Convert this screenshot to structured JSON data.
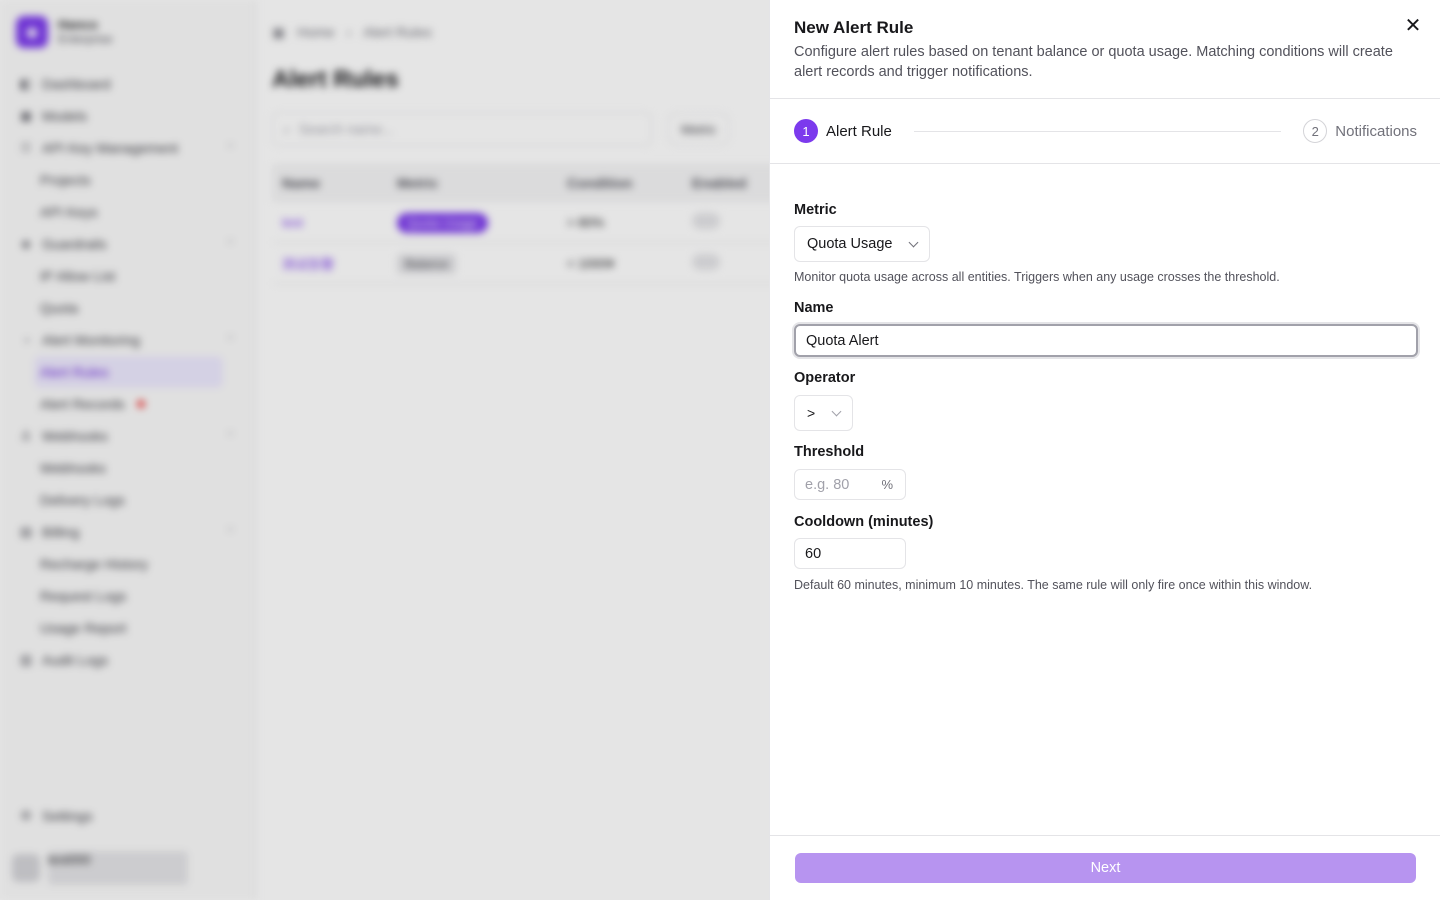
{
  "background": {
    "brand": {
      "name": "Hanco",
      "plan": "Enterprise"
    },
    "nav": [
      {
        "label": "Dashboard",
        "icon": "dashboard-icon",
        "level": 0
      },
      {
        "label": "Models",
        "icon": "box-icon",
        "level": 0
      },
      {
        "label": "API Key Management",
        "icon": "key-icon",
        "level": 0,
        "expanded": true
      },
      {
        "label": "Projects",
        "level": 1
      },
      {
        "label": "API Keys",
        "level": 1
      },
      {
        "label": "Guardrails",
        "icon": "shield-icon",
        "level": 0,
        "expanded": true
      },
      {
        "label": "IP Allow List",
        "level": 1
      },
      {
        "label": "Quota",
        "level": 1
      },
      {
        "label": "Alert Monitoring",
        "icon": "bell-icon",
        "level": 0,
        "expanded": true
      },
      {
        "label": "Alert Rules",
        "level": 1,
        "active": true
      },
      {
        "label": "Alert Records",
        "level": 1,
        "badge": true
      },
      {
        "label": "Webhooks",
        "icon": "webhook-icon",
        "level": 0,
        "expanded": true
      },
      {
        "label": "Webhooks",
        "level": 1
      },
      {
        "label": "Delivery Logs",
        "level": 1
      },
      {
        "label": "Billing",
        "icon": "billing-icon",
        "level": 0,
        "expanded": true
      },
      {
        "label": "Recharge History",
        "level": 1
      },
      {
        "label": "Request Logs",
        "level": 1
      },
      {
        "label": "Usage Report",
        "level": 1
      },
      {
        "label": "Audit Logs",
        "icon": "audit-icon",
        "level": 0
      }
    ],
    "settings_label": "Settings",
    "user_name": "test000",
    "breadcrumb": {
      "home": "Home",
      "current": "Alert Rules"
    },
    "page_title": "Alert Rules",
    "search_placeholder": "Search name...",
    "filter_label": "Metric",
    "table": {
      "headers": [
        "Name",
        "Metric",
        "Condition",
        "Enabled"
      ],
      "rows": [
        {
          "name": "test",
          "metric": "Quota Usage",
          "condition": "> 80%"
        },
        {
          "name": "测试告警",
          "metric": "Balance",
          "condition": "< 1000¥"
        }
      ]
    }
  },
  "sheet": {
    "title": "New Alert Rule",
    "description": "Configure alert rules based on tenant balance or quota usage. Matching conditions will create alert records and trigger notifications.",
    "steps": [
      {
        "number": "1",
        "label": "Alert Rule",
        "active": true
      },
      {
        "number": "2",
        "label": "Notifications",
        "active": false
      }
    ],
    "form": {
      "metric_label": "Metric",
      "metric_value": "Quota Usage",
      "metric_help": "Monitor quota usage across all entities. Triggers when any usage crosses the threshold.",
      "name_label": "Name",
      "name_value": "Quota Alert",
      "operator_label": "Operator",
      "operator_value": ">",
      "threshold_label": "Threshold",
      "threshold_placeholder": "e.g. 80",
      "threshold_suffix": "%",
      "cooldown_label": "Cooldown (minutes)",
      "cooldown_value": "60",
      "cooldown_help": "Default 60 minutes, minimum 10 minutes. The same rule will only fire once within this window."
    },
    "next_label": "Next",
    "colors": {
      "accent": "#7c3aed",
      "next_button": "#b794f0"
    }
  }
}
